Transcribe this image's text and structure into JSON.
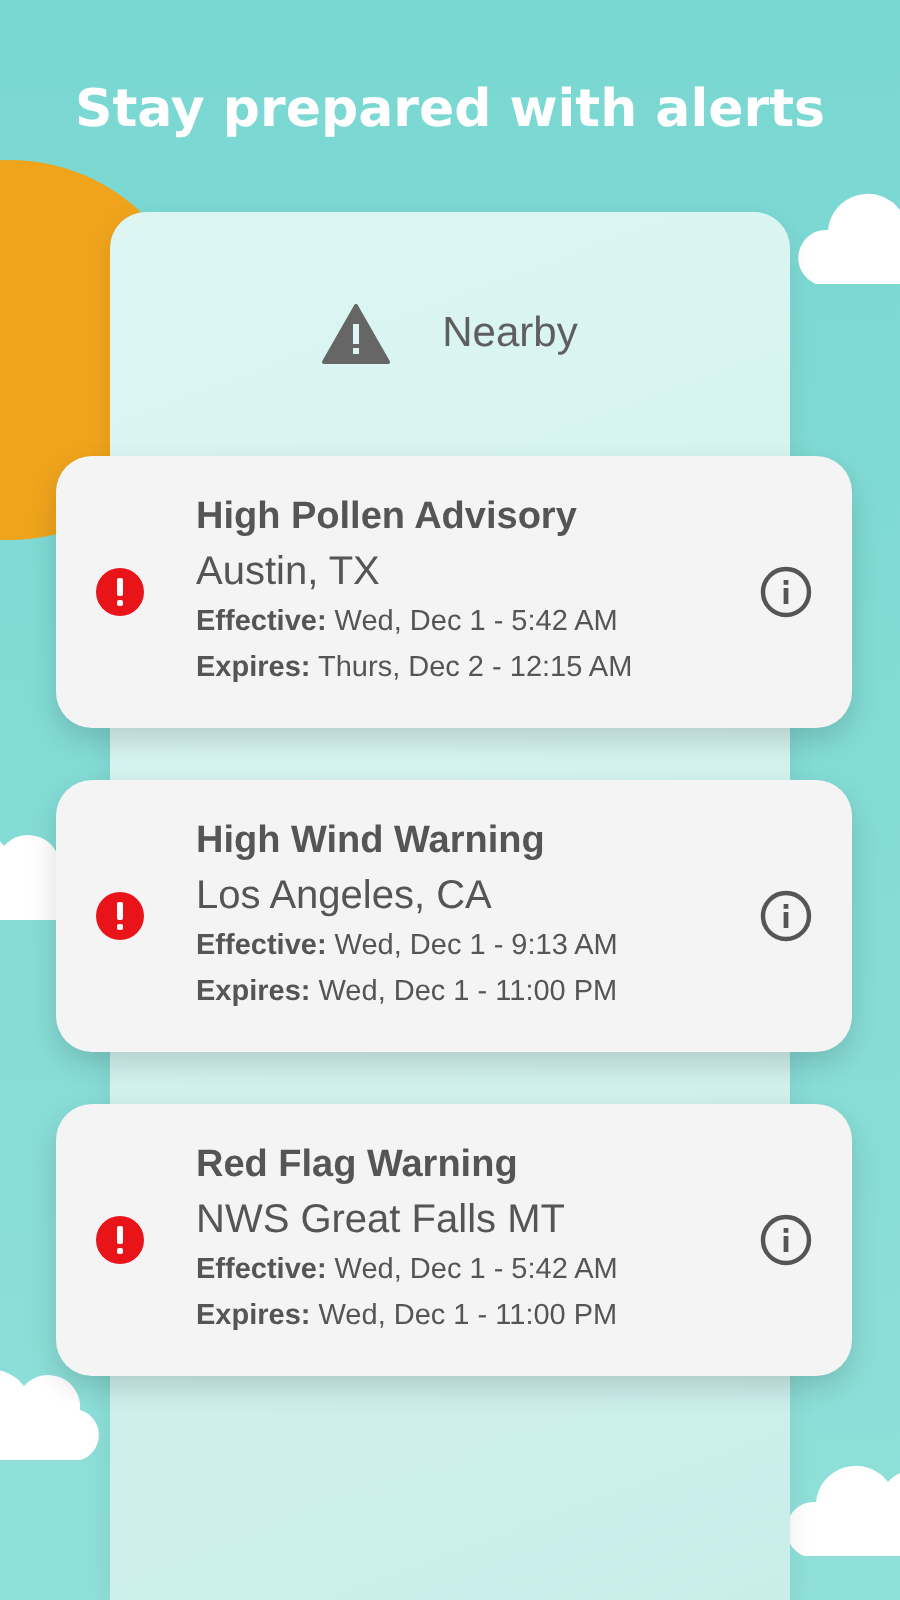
{
  "headline": "Stay prepared with alerts",
  "section": {
    "label": "Nearby"
  },
  "alerts": [
    {
      "title": "High Pollen Advisory",
      "location": "Austin, TX",
      "effective": "**Effective:** Wed, Dec 1 - 5:42 AM",
      "expires": "**Expires:** Thurs, Dec 2 - 12:15 AM"
    },
    {
      "title": "High Wind Warning",
      "location": "Los Angeles, CA",
      "effective": "**Effective:** Wed, Dec 1 - 9:13 AM",
      "expires": "**Expires:** Wed, Dec 1 - 11:00 PM"
    },
    {
      "title": "Red Flag Warning",
      "location": "NWS Great Falls MT",
      "effective": "**Effective:** Wed, Dec 1 - 5:42 AM",
      "expires": "**Expires:** Wed, Dec 1 - 11:00 PM"
    }
  ]
}
